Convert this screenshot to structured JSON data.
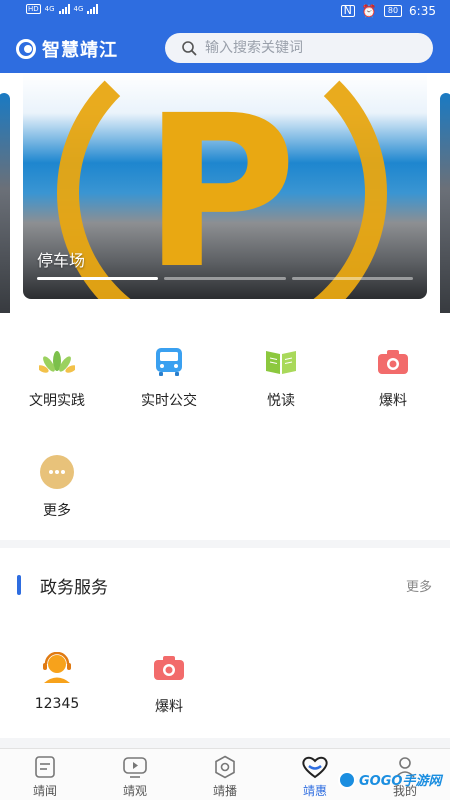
{
  "status_bar": {
    "time": "6:35",
    "battery": "80",
    "net1": "4G",
    "net2": "4G",
    "hd": "HD"
  },
  "header": {
    "app_name": "智慧靖江",
    "search_placeholder": "输入搜索关键词"
  },
  "banner": {
    "caption": "停车场",
    "total_slides": 3,
    "active_slide": 1,
    "logo_letter": "P"
  },
  "quick_actions": [
    {
      "label": "文明实践",
      "icon": "lotus-icon"
    },
    {
      "label": "实时公交",
      "icon": "bus-icon"
    },
    {
      "label": "悦读",
      "icon": "book-icon"
    },
    {
      "label": "爆料",
      "icon": "camera-icon"
    },
    {
      "label": "更多",
      "icon": "more-icon"
    }
  ],
  "gov_section": {
    "title": "政务服务",
    "more_label": "更多",
    "items": [
      {
        "label": "12345",
        "icon": "service-agent-icon"
      },
      {
        "label": "爆料",
        "icon": "camera-icon"
      }
    ]
  },
  "tabbar": [
    {
      "label": "靖闻",
      "icon": "news-icon",
      "active": false
    },
    {
      "label": "靖观",
      "icon": "video-icon",
      "active": false
    },
    {
      "label": "靖播",
      "icon": "broadcast-icon",
      "active": false
    },
    {
      "label": "靖惠",
      "icon": "heart-icon",
      "active": true
    },
    {
      "label": "我的",
      "icon": "profile-icon",
      "active": false
    }
  ],
  "watermark": {
    "text": "GOGO手游网"
  },
  "colors": {
    "brand": "#2e6de0",
    "accent": "#e9a812",
    "watermark": "#1b8ee0"
  }
}
